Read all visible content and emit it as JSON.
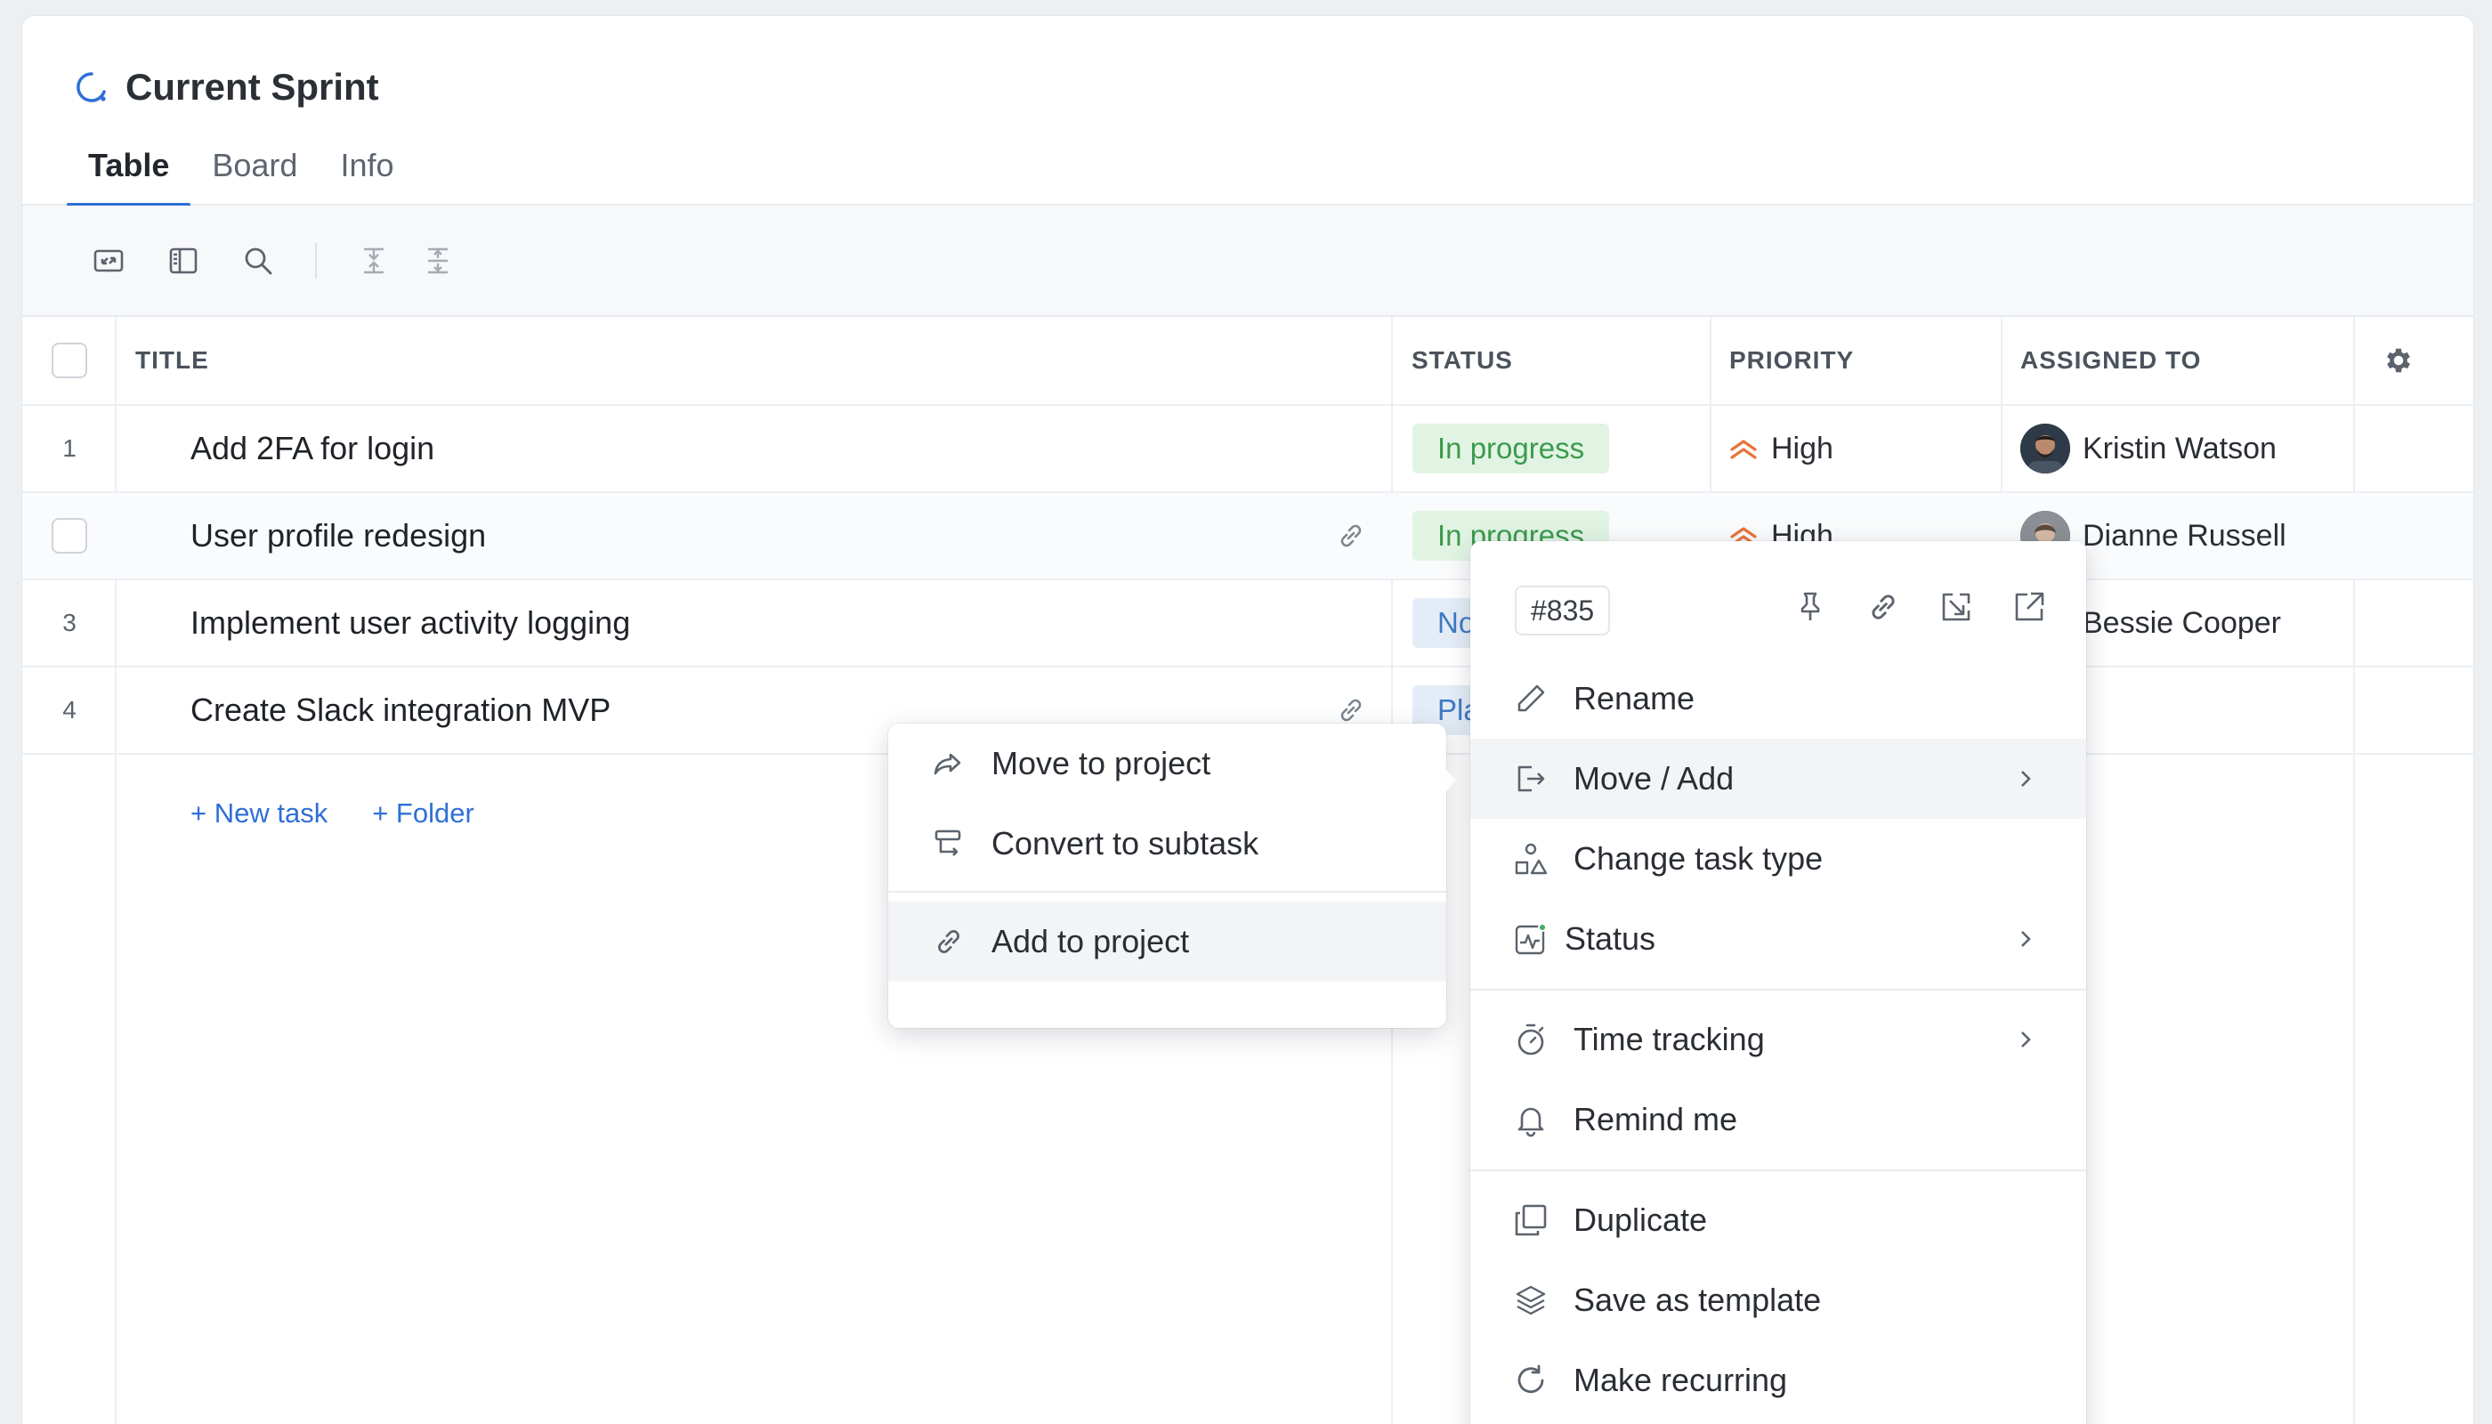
{
  "header": {
    "title": "Current Sprint"
  },
  "tabs": [
    {
      "label": "Table",
      "active": true
    },
    {
      "label": "Board",
      "active": false
    },
    {
      "label": "Info",
      "active": false
    }
  ],
  "toolbar": {
    "icons": [
      "expand-icon",
      "sidebar-layout-icon",
      "search-icon",
      "collapse-all-icon",
      "expand-all-icon"
    ]
  },
  "columns": {
    "title": "TITLE",
    "status": "STATUS",
    "priority": "PRIORITY",
    "assigned": "ASSIGNED TO"
  },
  "rows": [
    {
      "num": "1",
      "title": "Add 2FA for login",
      "status": "In progress",
      "priority": "High",
      "assignee": "Kristin Watson"
    },
    {
      "num": "",
      "title": "User profile redesign",
      "status": "In progress",
      "priority": "High",
      "assignee": "Dianne Russell"
    },
    {
      "num": "3",
      "title": "Implement user activity logging",
      "status": "No",
      "priority": "",
      "assignee": "Bessie Cooper"
    },
    {
      "num": "4",
      "title": "Create Slack integration MVP",
      "status": "Pla",
      "priority": "",
      "assignee": ""
    }
  ],
  "add": {
    "new_task": "+ New task",
    "folder": "+ Folder"
  },
  "context_menu": {
    "task_id": "#835",
    "items": {
      "rename": "Rename",
      "move_add": "Move / Add",
      "change_type": "Change task type",
      "status": "Status",
      "time_tracking": "Time tracking",
      "remind": "Remind me",
      "duplicate": "Duplicate",
      "template": "Save as template",
      "recurring": "Make recurring"
    }
  },
  "submenu": {
    "move_to_project": "Move to project",
    "convert_subtask": "Convert to subtask",
    "add_to_project": "Add to project"
  },
  "colors": {
    "accent": "#2f6fd6",
    "status_progress_bg": "#e1f4e3",
    "status_progress_text": "#3c9a4f",
    "priority_high": "#e8743b"
  }
}
